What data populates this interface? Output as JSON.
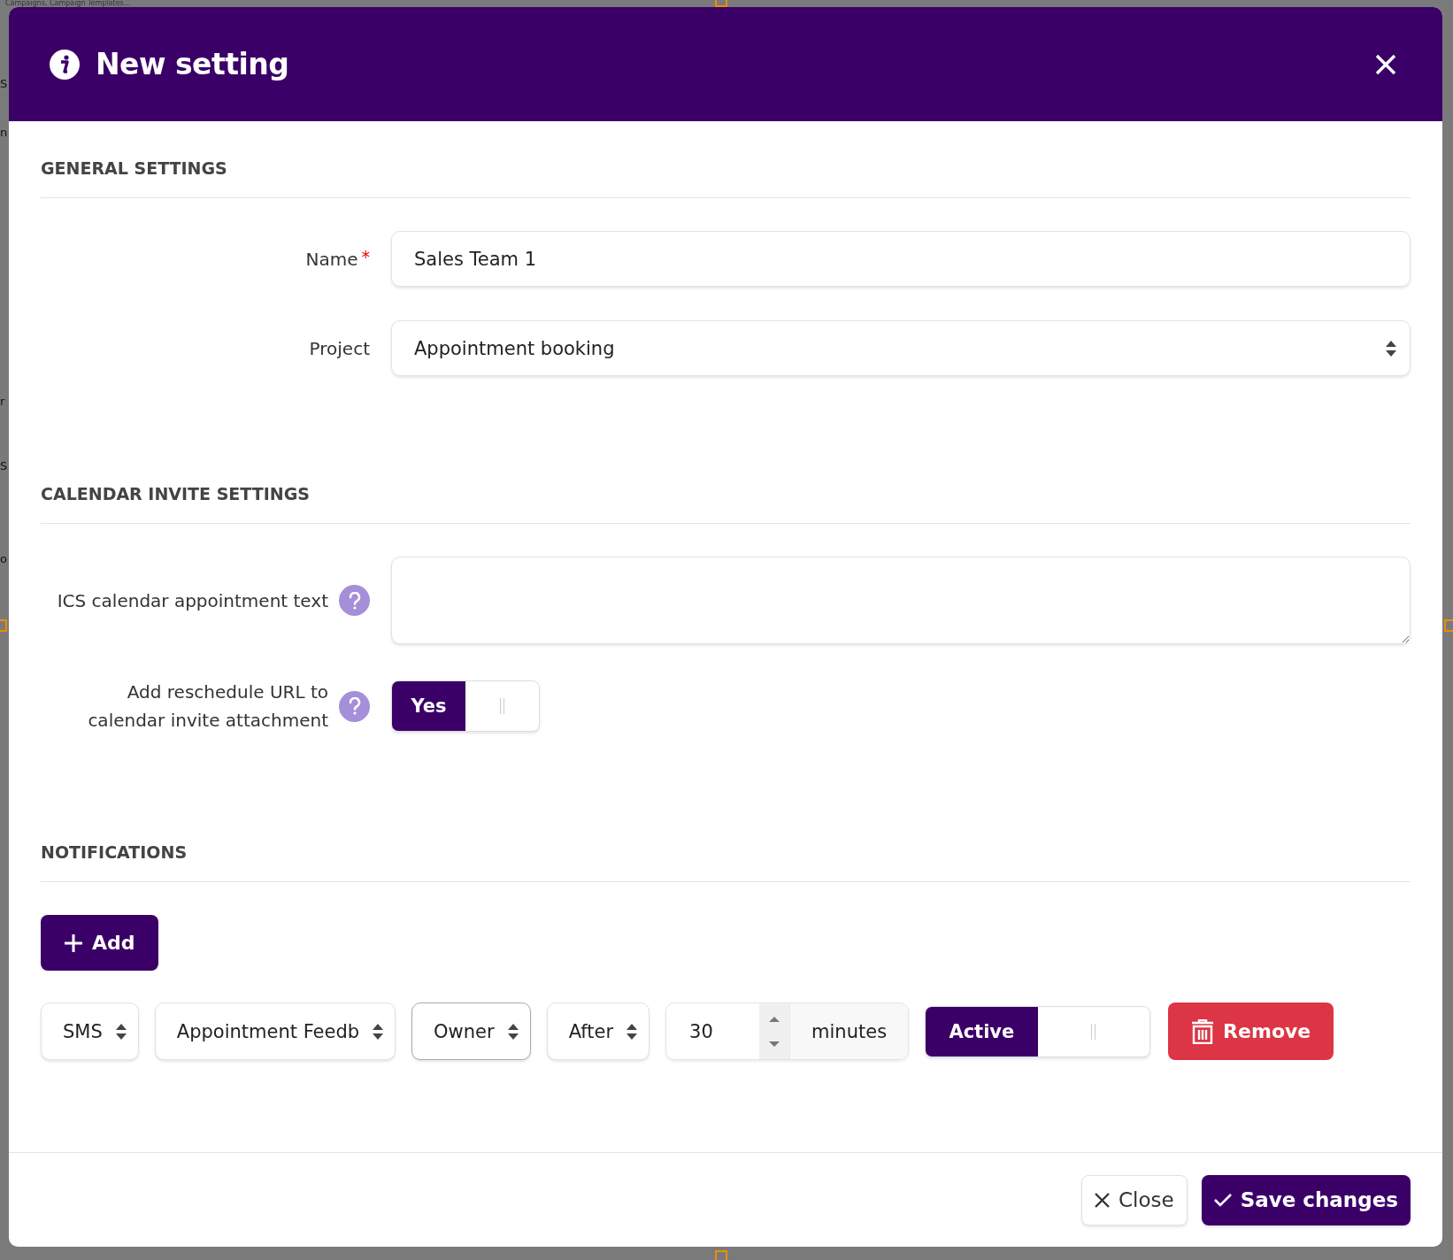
{
  "backdrop": {
    "top_text": "Campaigns, Campaign Templates...",
    "side_fragments": [
      "S",
      "n",
      "r",
      "S",
      "o"
    ]
  },
  "dialog": {
    "title": "New setting"
  },
  "sections": [
    {
      "kind": "form",
      "title": "GENERAL SETTINGS",
      "fields": [
        {
          "kind": "text",
          "label": "Name",
          "required_mark": "*",
          "help": false,
          "value": "Sales Team 1"
        },
        {
          "kind": "select",
          "label": "Project",
          "help": false,
          "value": "Appointment booking"
        }
      ]
    },
    {
      "kind": "form",
      "title": "CALENDAR INVITE SETTINGS",
      "fields": [
        {
          "kind": "textarea",
          "label": "ICS calendar appointment text",
          "help": true
        },
        {
          "kind": "toggle",
          "label": "Add reschedule URL to calendar invite attachment",
          "help": true,
          "on": true,
          "on_label": "Yes"
        }
      ]
    },
    {
      "kind": "notifications",
      "title": "NOTIFICATIONS",
      "add_label": "Add",
      "rows": [
        {
          "channel": "SMS",
          "template": "Appointment Feedb",
          "recipient": "Owner",
          "recipient_focused": true,
          "timing": "After",
          "amount": "30",
          "unit": "minutes",
          "active": true,
          "active_label": "Active",
          "remove_label": "Remove"
        }
      ]
    }
  ],
  "footer": {
    "buttons": [
      {
        "kind": "close",
        "label": "Close"
      },
      {
        "kind": "save",
        "label": "Save changes"
      }
    ]
  }
}
